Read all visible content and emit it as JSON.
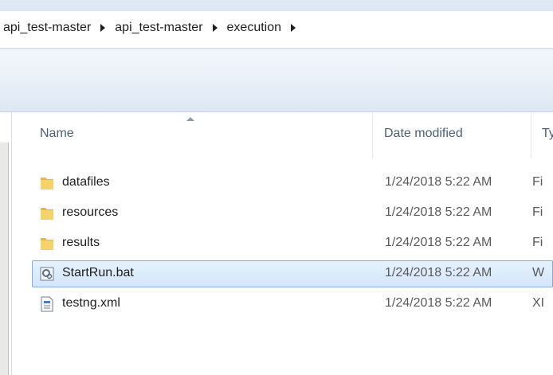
{
  "breadcrumb": [
    "api_test-master",
    "api_test-master",
    "execution"
  ],
  "columns": {
    "name": "Name",
    "date": "Date modified",
    "type": "Ty"
  },
  "files": [
    {
      "name": "datafiles",
      "date": "1/24/2018 5:22 AM",
      "type": "Fi",
      "icon": "folder-icon",
      "selected": false
    },
    {
      "name": "resources",
      "date": "1/24/2018 5:22 AM",
      "type": "Fi",
      "icon": "folder-icon",
      "selected": false
    },
    {
      "name": "results",
      "date": "1/24/2018 5:22 AM",
      "type": "Fi",
      "icon": "folder-icon",
      "selected": false
    },
    {
      "name": "StartRun.bat",
      "date": "1/24/2018 5:22 AM",
      "type": "W",
      "icon": "batch-file-icon",
      "selected": true
    },
    {
      "name": "testng.xml",
      "date": "1/24/2018 5:22 AM",
      "type": "XI",
      "icon": "xml-file-icon",
      "selected": false
    }
  ],
  "colors": {
    "selection": "#d3e6fb",
    "selection_border": "#84acdd",
    "folder": "#e8b93a",
    "header_text": "#4c607a"
  }
}
